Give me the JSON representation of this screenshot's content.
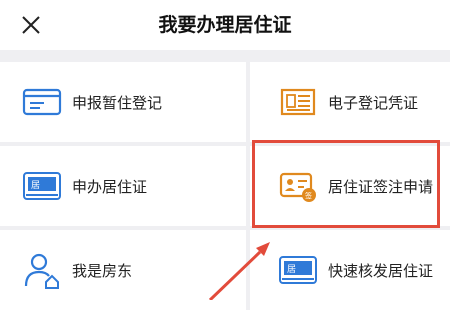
{
  "header": {
    "title": "我要办理居住证",
    "close_icon": "close-icon"
  },
  "cards": [
    {
      "label": "申报暂住登记",
      "icon": "id-card-form-icon"
    },
    {
      "label": "电子登记凭证",
      "icon": "document-lines-icon"
    },
    {
      "label": "申办居住证",
      "icon": "residence-card-icon"
    },
    {
      "label": "居住证签注申请",
      "icon": "endorsement-card-icon"
    },
    {
      "label": "我是房东",
      "icon": "landlord-person-icon"
    },
    {
      "label": "快速核发居住证",
      "icon": "residence-card-icon"
    }
  ],
  "colors": {
    "accent_blue": "#2f7ad8",
    "accent_orange": "#e0891e",
    "highlight_red": "#e24b3b"
  }
}
